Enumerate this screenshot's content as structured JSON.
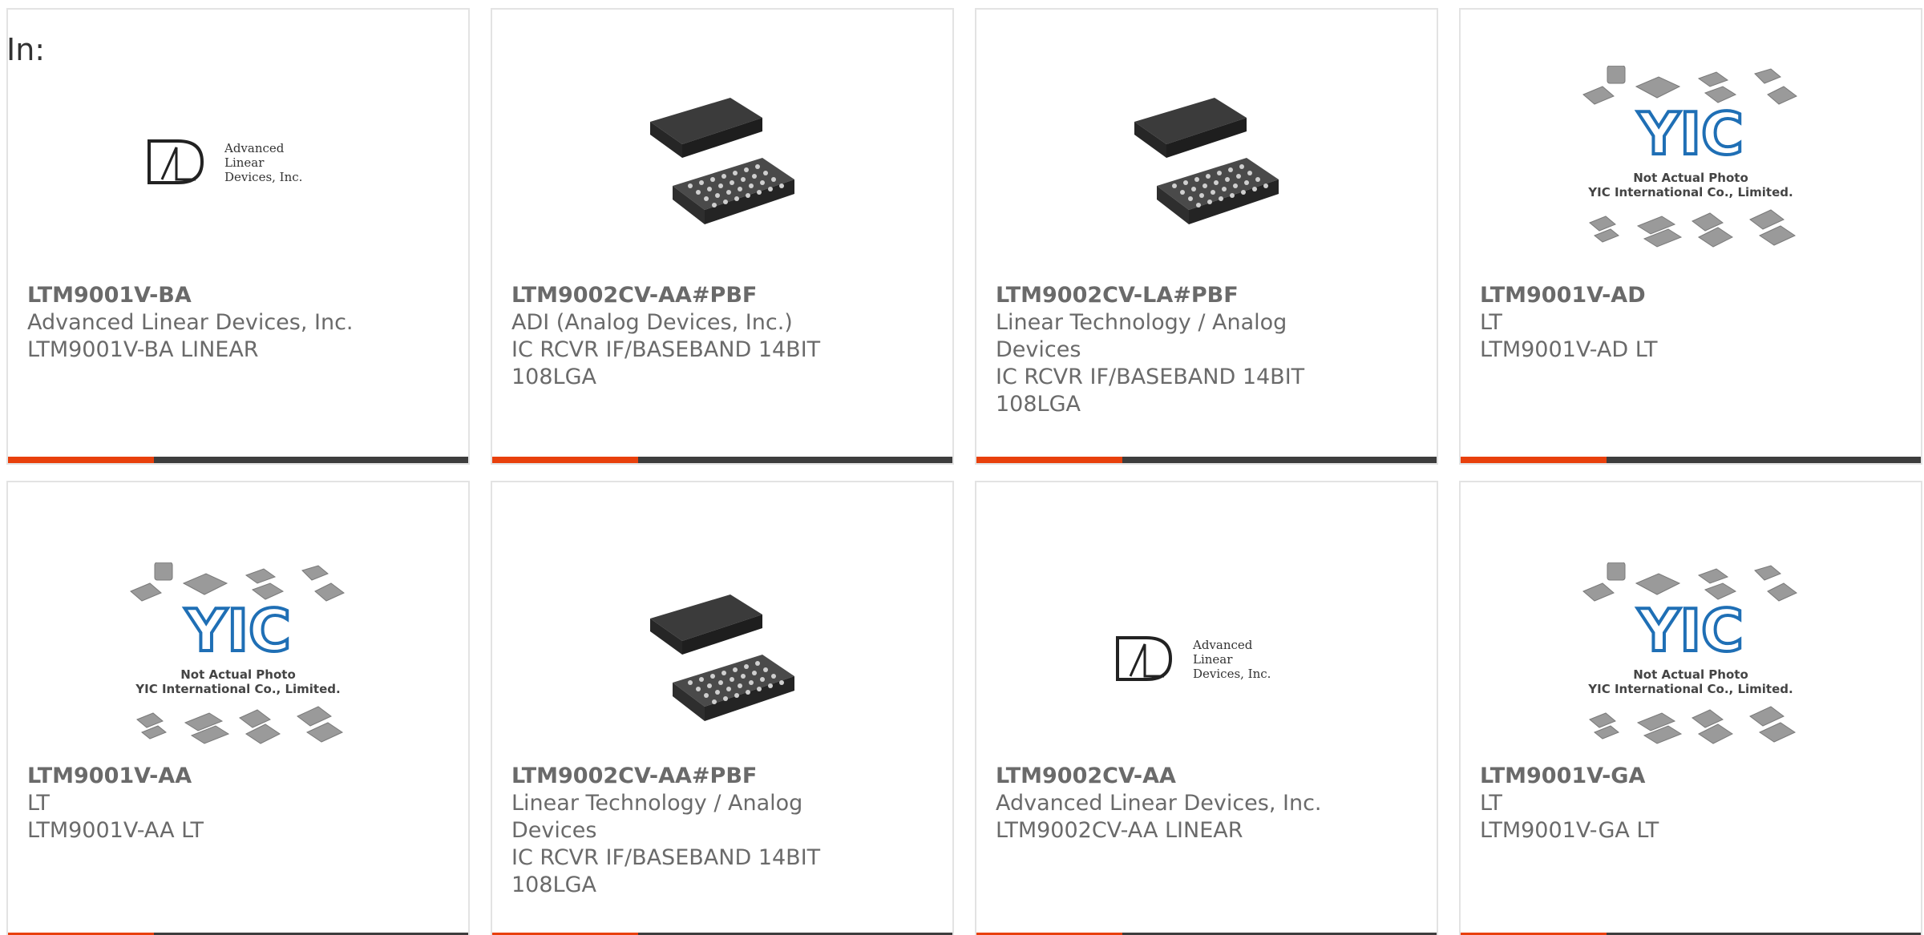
{
  "header": {
    "in_label": "In:"
  },
  "colors": {
    "accent": "#e8400c",
    "bar": "#3d3d3d",
    "text": "#6a6a6a"
  },
  "products": [
    {
      "part": "LTM9001V-BA",
      "manufacturer": "Advanced Linear Devices, Inc.",
      "description": "LTM9001V-BA LINEAR",
      "image": "ald-logo"
    },
    {
      "part": "LTM9002CV-AA#PBF",
      "manufacturer": "ADI (Analog Devices, Inc.)",
      "description": "IC RCVR IF/BASEBAND 14BIT 108LGA",
      "image": "lga-chip"
    },
    {
      "part": "LTM9002CV-LA#PBF",
      "manufacturer": "Linear Technology / Analog Devices",
      "description": "IC RCVR IF/BASEBAND 14BIT 108LGA",
      "image": "lga-chip"
    },
    {
      "part": "LTM9001V-AD",
      "manufacturer": "LT",
      "description": "LTM9001V-AD LT",
      "image": "yic-placeholder"
    },
    {
      "part": "LTM9001V-AA",
      "manufacturer": "LT",
      "description": "LTM9001V-AA LT",
      "image": "yic-placeholder"
    },
    {
      "part": "LTM9002CV-AA#PBF",
      "manufacturer": "Linear Technology / Analog Devices",
      "description": "IC RCVR IF/BASEBAND 14BIT 108LGA",
      "image": "lga-chip"
    },
    {
      "part": "LTM9002CV-AA",
      "manufacturer": "Advanced Linear Devices, Inc.",
      "description": "LTM9002CV-AA LINEAR",
      "image": "ald-logo"
    },
    {
      "part": "LTM9001V-GA",
      "manufacturer": "LT",
      "description": "LTM9001V-GA LT",
      "image": "yic-placeholder"
    }
  ],
  "ald_logo": {
    "line1": "Advanced",
    "line2": "Linear",
    "line3": "Devices, Inc."
  },
  "yic": {
    "caption1": "Not Actual Photo",
    "caption2": "YIC International Co., Limited.",
    "mark": "YIC"
  }
}
